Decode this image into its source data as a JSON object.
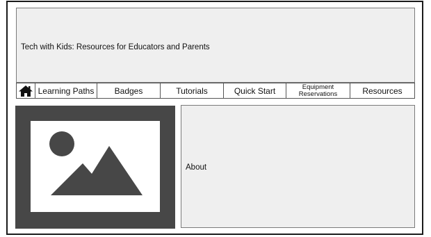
{
  "header": {
    "title": "Tech with Kids: Resources for Educators and Parents"
  },
  "nav": {
    "home_icon": "home-icon",
    "items": [
      {
        "label": "Learning Paths"
      },
      {
        "label": "Badges"
      },
      {
        "label": "Tutorials"
      },
      {
        "label": "Quick Start"
      },
      {
        "label": "Equipment Reservations"
      },
      {
        "label": "Resources"
      }
    ]
  },
  "hero_image": {
    "icon": "image-placeholder-icon"
  },
  "about": {
    "label": "About"
  },
  "colors": {
    "panel_bg": "#efefef",
    "image_bg": "#474747",
    "frame": "#1a1a1a"
  }
}
